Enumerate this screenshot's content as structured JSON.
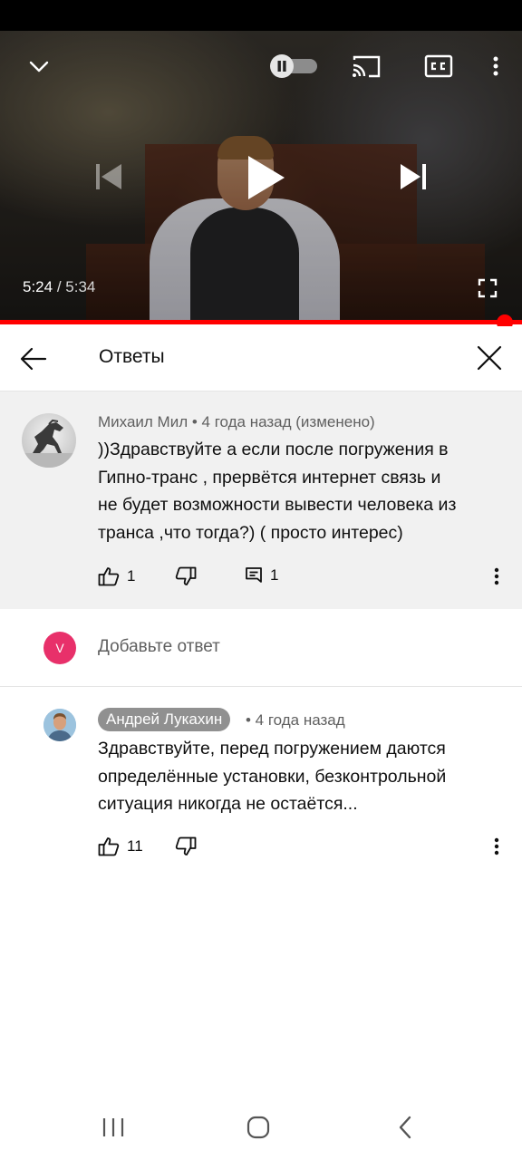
{
  "player": {
    "current_time": "5:24",
    "separator": "/",
    "duration": "5:34",
    "progress_fraction": 0.97,
    "state": "paused",
    "autoplay": "on",
    "icons": [
      "chevron-down-icon",
      "pause-icon",
      "cast-icon",
      "cc-icon",
      "more-vert-icon",
      "skip-previous-icon",
      "play-icon",
      "skip-next-icon",
      "fullscreen-icon"
    ]
  },
  "header": {
    "title": "Ответы",
    "back_icon": "arrow-left-icon",
    "close_icon": "close-icon"
  },
  "parent_comment": {
    "author": "Михаил Мил",
    "meta_suffix": " • 4 года назад (изменено)",
    "text": "))Здравствуйте а если после погружения в\nГипно-транс , прервётся интернет связь и\nне будет возможности вывести человека из\nтранса ,что тогда?)  ( просто интерес)",
    "likes": "1",
    "replies": "1"
  },
  "reply_box": {
    "user_initial": "V",
    "placeholder": "Добавьте ответ",
    "avatar_color": "#e8306a"
  },
  "reply": {
    "author": "Андрей Лукахин",
    "meta": " • 4 года назад",
    "text": "Здравствуйте, перед погружением даются\nопределённые установки, безконтрольной\nситуация никогда не остаётся...",
    "likes": "11"
  },
  "colors": {
    "progress": "#ff0000",
    "parent_bg": "#f1f1f1",
    "author_badge_bg": "#909090"
  }
}
